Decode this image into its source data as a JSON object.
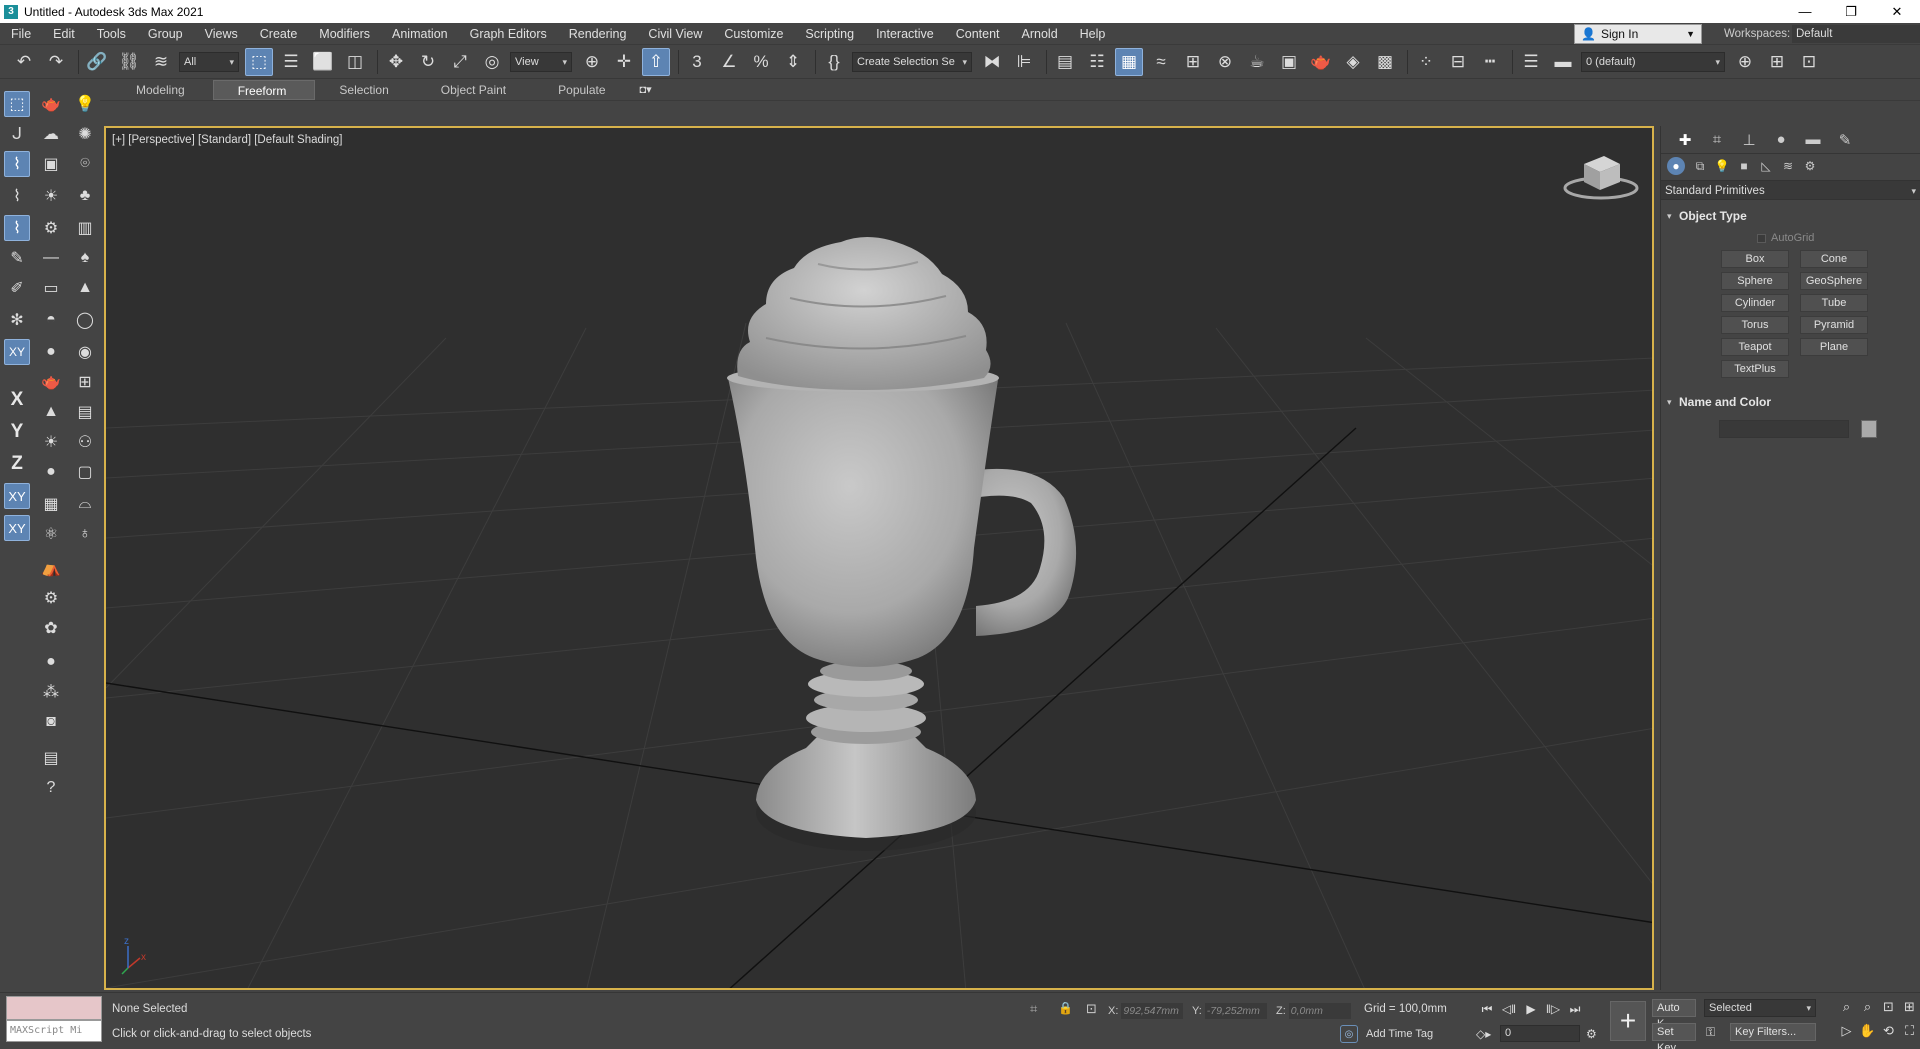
{
  "window": {
    "title": "Untitled - Autodesk 3ds Max 2021",
    "app_icon": "3",
    "controls": [
      "—",
      "❐",
      "✕"
    ]
  },
  "menu": {
    "items": [
      "File",
      "Edit",
      "Tools",
      "Group",
      "Views",
      "Create",
      "Modifiers",
      "Animation",
      "Graph Editors",
      "Rendering",
      "Civil View",
      "Customize",
      "Scripting",
      "Interactive",
      "Content",
      "Arnold",
      "Help"
    ],
    "sign_in": "Sign In",
    "workspaces_label": "Workspaces:",
    "workspace_value": "Default"
  },
  "toolbar": {
    "selection_filter": "All",
    "ref_coord": "View",
    "named_selection": "Create Selection Se",
    "layer": "0 (default)"
  },
  "ribbon": {
    "tabs": [
      "Modeling",
      "Freeform",
      "Selection",
      "Object Paint",
      "Populate"
    ],
    "active_tab": "Freeform"
  },
  "left_axes": [
    "X",
    "Y",
    "Z",
    "XY",
    "XY"
  ],
  "viewport": {
    "label": "[+] [Perspective] [Standard] [Default Shading]",
    "border_color": "#d7b24b",
    "background": "#2f2f2f",
    "axis_x": "x",
    "axis_z": "z"
  },
  "command_panel": {
    "category": "Standard Primitives",
    "object_type_title": "Object Type",
    "autogrid_label": "AutoGrid",
    "primitives": [
      "Box",
      "Cone",
      "Sphere",
      "GeoSphere",
      "Cylinder",
      "Tube",
      "Torus",
      "Pyramid",
      "Teapot",
      "Plane",
      "TextPlus"
    ],
    "name_color_title": "Name and Color",
    "object_color": "#aaaaaa"
  },
  "status": {
    "maxscript_placeholder": "MAXScript Mi",
    "selection_status": "None Selected",
    "prompt": "Click or click-and-drag to select objects",
    "x_label": "X:",
    "x_value": "992,547mm",
    "y_label": "Y:",
    "y_value": "-79,252mm",
    "z_label": "Z:",
    "z_value": "0,0mm",
    "grid": "Grid = 100,0mm",
    "add_time_tag": "Add Time Tag",
    "frame_value": "0",
    "auto_key": "Auto K...",
    "set_key": "Set Key",
    "key_mode": "Selected",
    "key_filters": "Key Filters..."
  }
}
